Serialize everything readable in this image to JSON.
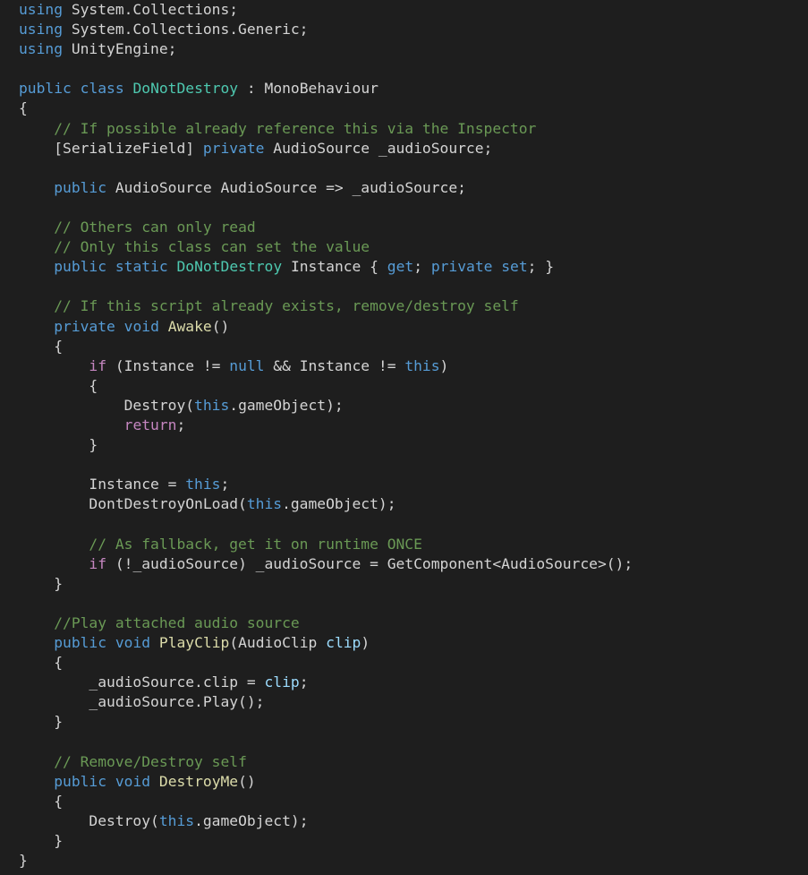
{
  "colors": {
    "background": "#1e1e1e",
    "plain": "#d4d4d4",
    "keyword": "#569cd6",
    "control": "#c586c0",
    "type": "#4ec9b0",
    "function": "#dcdcaa",
    "variable": "#9cdcfe",
    "comment": "#6a9955"
  },
  "code": {
    "lines": [
      [
        {
          "t": "kw",
          "s": "using"
        },
        {
          "t": "pl",
          "s": " System.Collections;"
        }
      ],
      [
        {
          "t": "kw",
          "s": "using"
        },
        {
          "t": "pl",
          "s": " System.Collections.Generic;"
        }
      ],
      [
        {
          "t": "kw",
          "s": "using"
        },
        {
          "t": "pl",
          "s": " UnityEngine;"
        }
      ],
      [],
      [
        {
          "t": "kw",
          "s": "public"
        },
        {
          "t": "pl",
          "s": " "
        },
        {
          "t": "kw",
          "s": "class"
        },
        {
          "t": "pl",
          "s": " "
        },
        {
          "t": "type",
          "s": "DoNotDestroy"
        },
        {
          "t": "pl",
          "s": " : MonoBehaviour"
        }
      ],
      [
        {
          "t": "pl",
          "s": "{"
        }
      ],
      [
        {
          "t": "pl",
          "s": "    "
        },
        {
          "t": "cm",
          "s": "// If possible already reference this via the Inspector"
        }
      ],
      [
        {
          "t": "pl",
          "s": "    [SerializeField] "
        },
        {
          "t": "kw",
          "s": "private"
        },
        {
          "t": "pl",
          "s": " AudioSource _audioSource;"
        }
      ],
      [],
      [
        {
          "t": "pl",
          "s": "    "
        },
        {
          "t": "kw",
          "s": "public"
        },
        {
          "t": "pl",
          "s": " AudioSource AudioSource => _audioSource;"
        }
      ],
      [],
      [
        {
          "t": "pl",
          "s": "    "
        },
        {
          "t": "cm",
          "s": "// Others can only read"
        }
      ],
      [
        {
          "t": "pl",
          "s": "    "
        },
        {
          "t": "cm",
          "s": "// Only this class can set the value"
        }
      ],
      [
        {
          "t": "pl",
          "s": "    "
        },
        {
          "t": "kw",
          "s": "public"
        },
        {
          "t": "pl",
          "s": " "
        },
        {
          "t": "kw",
          "s": "static"
        },
        {
          "t": "pl",
          "s": " "
        },
        {
          "t": "type",
          "s": "DoNotDestroy"
        },
        {
          "t": "pl",
          "s": " Instance { "
        },
        {
          "t": "kw",
          "s": "get"
        },
        {
          "t": "pl",
          "s": "; "
        },
        {
          "t": "kw",
          "s": "private"
        },
        {
          "t": "pl",
          "s": " "
        },
        {
          "t": "kw",
          "s": "set"
        },
        {
          "t": "pl",
          "s": "; }"
        }
      ],
      [],
      [
        {
          "t": "pl",
          "s": "    "
        },
        {
          "t": "cm",
          "s": "// If this script already exists, remove/destroy self"
        }
      ],
      [
        {
          "t": "pl",
          "s": "    "
        },
        {
          "t": "kw",
          "s": "private"
        },
        {
          "t": "pl",
          "s": " "
        },
        {
          "t": "kw",
          "s": "void"
        },
        {
          "t": "pl",
          "s": " "
        },
        {
          "t": "fn",
          "s": "Awake"
        },
        {
          "t": "pl",
          "s": "()"
        }
      ],
      [
        {
          "t": "pl",
          "s": "    {"
        }
      ],
      [
        {
          "t": "pl",
          "s": "        "
        },
        {
          "t": "ctl",
          "s": "if"
        },
        {
          "t": "pl",
          "s": " (Instance != "
        },
        {
          "t": "kw",
          "s": "null"
        },
        {
          "t": "pl",
          "s": " && Instance != "
        },
        {
          "t": "kw",
          "s": "this"
        },
        {
          "t": "pl",
          "s": ")"
        }
      ],
      [
        {
          "t": "pl",
          "s": "        {"
        }
      ],
      [
        {
          "t": "pl",
          "s": "            Destroy("
        },
        {
          "t": "kw",
          "s": "this"
        },
        {
          "t": "pl",
          "s": ".gameObject);"
        }
      ],
      [
        {
          "t": "pl",
          "s": "            "
        },
        {
          "t": "ctl",
          "s": "return"
        },
        {
          "t": "pl",
          "s": ";"
        }
      ],
      [
        {
          "t": "pl",
          "s": "        }"
        }
      ],
      [],
      [
        {
          "t": "pl",
          "s": "        Instance = "
        },
        {
          "t": "kw",
          "s": "this"
        },
        {
          "t": "pl",
          "s": ";"
        }
      ],
      [
        {
          "t": "pl",
          "s": "        DontDestroyOnLoad("
        },
        {
          "t": "kw",
          "s": "this"
        },
        {
          "t": "pl",
          "s": ".gameObject);"
        }
      ],
      [],
      [
        {
          "t": "pl",
          "s": "        "
        },
        {
          "t": "cm",
          "s": "// As fallback, get it on runtime ONCE"
        }
      ],
      [
        {
          "t": "pl",
          "s": "        "
        },
        {
          "t": "ctl",
          "s": "if"
        },
        {
          "t": "pl",
          "s": " (!_audioSource) _audioSource = GetComponent<AudioSource>();"
        }
      ],
      [
        {
          "t": "pl",
          "s": "    }"
        }
      ],
      [],
      [
        {
          "t": "pl",
          "s": "    "
        },
        {
          "t": "cm",
          "s": "//Play attached audio source"
        }
      ],
      [
        {
          "t": "pl",
          "s": "    "
        },
        {
          "t": "kw",
          "s": "public"
        },
        {
          "t": "pl",
          "s": " "
        },
        {
          "t": "kw",
          "s": "void"
        },
        {
          "t": "pl",
          "s": " "
        },
        {
          "t": "fn",
          "s": "PlayClip"
        },
        {
          "t": "pl",
          "s": "(AudioClip "
        },
        {
          "t": "var",
          "s": "clip"
        },
        {
          "t": "pl",
          "s": ")"
        }
      ],
      [
        {
          "t": "pl",
          "s": "    {"
        }
      ],
      [
        {
          "t": "pl",
          "s": "        _audioSource.clip = "
        },
        {
          "t": "var",
          "s": "clip"
        },
        {
          "t": "pl",
          "s": ";"
        }
      ],
      [
        {
          "t": "pl",
          "s": "        _audioSource.Play();"
        }
      ],
      [
        {
          "t": "pl",
          "s": "    }"
        }
      ],
      [],
      [
        {
          "t": "pl",
          "s": "    "
        },
        {
          "t": "cm",
          "s": "// Remove/Destroy self"
        }
      ],
      [
        {
          "t": "pl",
          "s": "    "
        },
        {
          "t": "kw",
          "s": "public"
        },
        {
          "t": "pl",
          "s": " "
        },
        {
          "t": "kw",
          "s": "void"
        },
        {
          "t": "pl",
          "s": " "
        },
        {
          "t": "fn",
          "s": "DestroyMe"
        },
        {
          "t": "pl",
          "s": "()"
        }
      ],
      [
        {
          "t": "pl",
          "s": "    {"
        }
      ],
      [
        {
          "t": "pl",
          "s": "        Destroy("
        },
        {
          "t": "kw",
          "s": "this"
        },
        {
          "t": "pl",
          "s": ".gameObject);"
        }
      ],
      [
        {
          "t": "pl",
          "s": "    }"
        }
      ],
      [
        {
          "t": "pl",
          "s": "}"
        }
      ]
    ]
  }
}
